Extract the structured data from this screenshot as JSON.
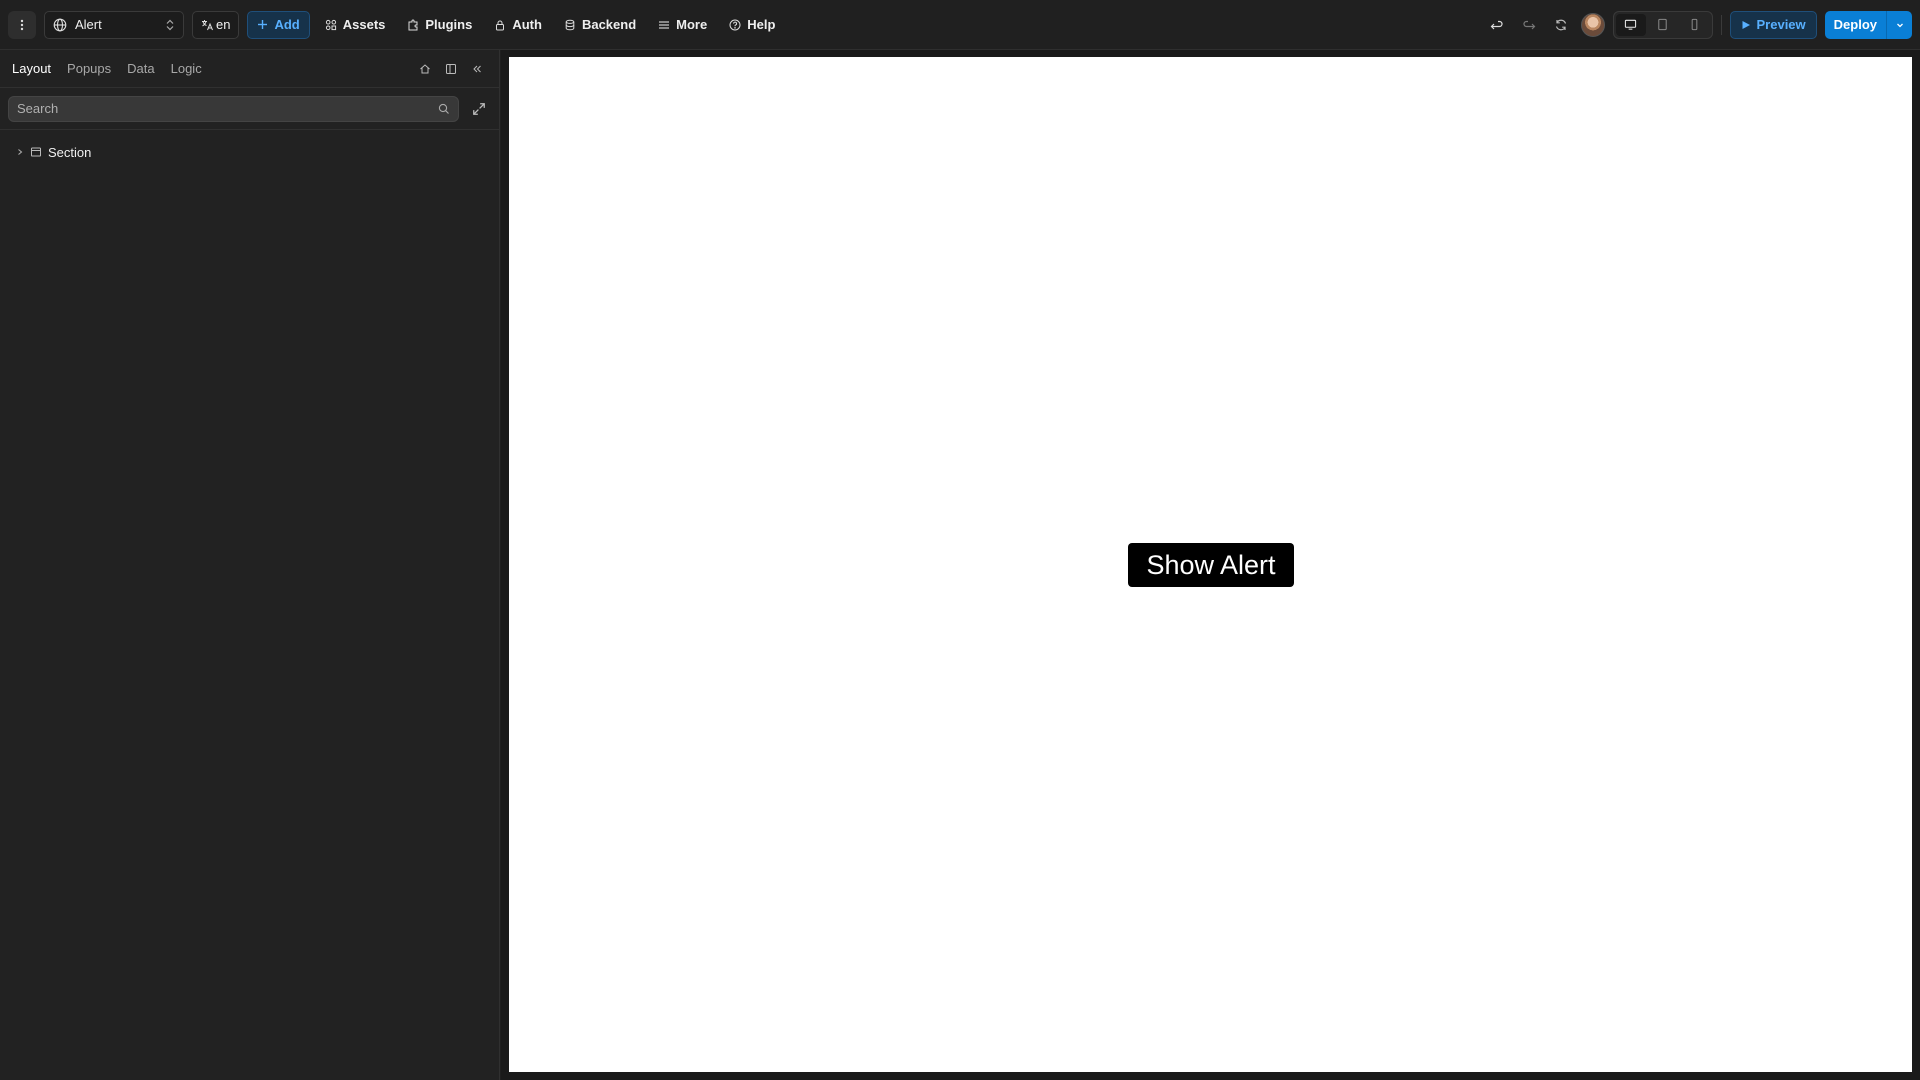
{
  "topbar": {
    "page_select": {
      "label": "Alert",
      "icon": "globe-icon"
    },
    "language": {
      "label": "en",
      "icon": "translate-icon"
    },
    "add_label": "Add",
    "nav": [
      {
        "label": "Assets",
        "icon": "assets-icon"
      },
      {
        "label": "Plugins",
        "icon": "plugin-icon"
      },
      {
        "label": "Auth",
        "icon": "lock-icon"
      },
      {
        "label": "Backend",
        "icon": "database-icon"
      },
      {
        "label": "More",
        "icon": "menu-lines-icon"
      },
      {
        "label": "Help",
        "icon": "help-circle-icon"
      }
    ],
    "preview_label": "Preview",
    "deploy_label": "Deploy",
    "accent_color": "#0a7fd6"
  },
  "sidebar": {
    "tabs": [
      {
        "label": "Layout",
        "active": true
      },
      {
        "label": "Popups",
        "active": false
      },
      {
        "label": "Data",
        "active": false
      },
      {
        "label": "Logic",
        "active": false
      }
    ],
    "search": {
      "placeholder": "Search",
      "value": ""
    },
    "tree": [
      {
        "label": "Section",
        "expanded": false,
        "icon": "section-icon"
      }
    ]
  },
  "canvas": {
    "button_label": "Show Alert"
  }
}
